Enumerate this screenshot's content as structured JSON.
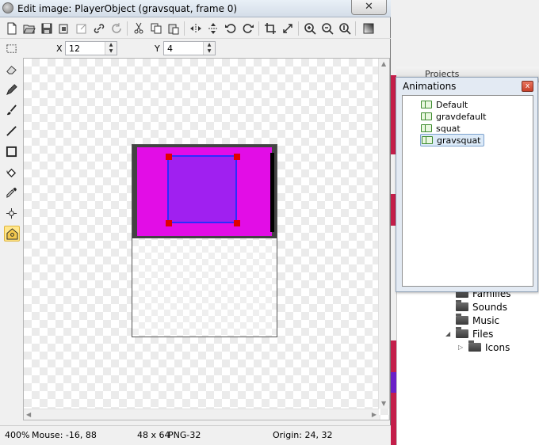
{
  "window": {
    "title": "Edit image: PlayerObject (gravsquat, frame 0)",
    "close_glyph": "✕"
  },
  "toolbar": {
    "icons": [
      "new-icon",
      "open-icon",
      "save-icon",
      "copy-image-icon",
      "export-icon",
      "link-icon",
      "refresh-icon",
      "cut-icon",
      "copy-icon",
      "paste-icon",
      "mirror-icon",
      "flip-icon",
      "rotate-left-icon",
      "rotate-right-icon",
      "crop-icon",
      "resize-icon",
      "zoom-in-icon",
      "zoom-out-icon",
      "zoom-reset-icon",
      "gradient-icon"
    ]
  },
  "coords": {
    "x_label": "X",
    "x_value": "12",
    "y_label": "Y",
    "y_value": "4"
  },
  "tools": [
    "rect-select-icon",
    "eraser-icon",
    "pencil-icon",
    "brush-icon",
    "line-icon",
    "rectangle-icon",
    "fill-icon",
    "eyedropper-icon",
    "origin-icon",
    "action-point-icon"
  ],
  "status": {
    "zoom": "400%",
    "mouse": "Mouse: -16, 88",
    "size": "48 x 64",
    "format": "PNG-32",
    "origin": "Origin: 24, 32"
  },
  "animations": {
    "title": "Animations",
    "close_glyph": "x",
    "items": [
      {
        "label": "Default",
        "selected": false
      },
      {
        "label": "gravdefault",
        "selected": false
      },
      {
        "label": "squat",
        "selected": false
      },
      {
        "label": "gravsquat",
        "selected": true
      }
    ]
  },
  "project_panel": {
    "title": "Projects",
    "tree": [
      {
        "label": "Families",
        "expander": ""
      },
      {
        "label": "Sounds",
        "expander": ""
      },
      {
        "label": "Music",
        "expander": ""
      },
      {
        "label": "Files",
        "expander": "◢"
      },
      {
        "label": "Icons",
        "expander": "▷"
      }
    ]
  },
  "colors": {
    "sprite_magenta": "#e20de6",
    "sprite_purple": "#a020f0",
    "selection_blue": "#2c2cff",
    "handle_red": "#e00000"
  }
}
